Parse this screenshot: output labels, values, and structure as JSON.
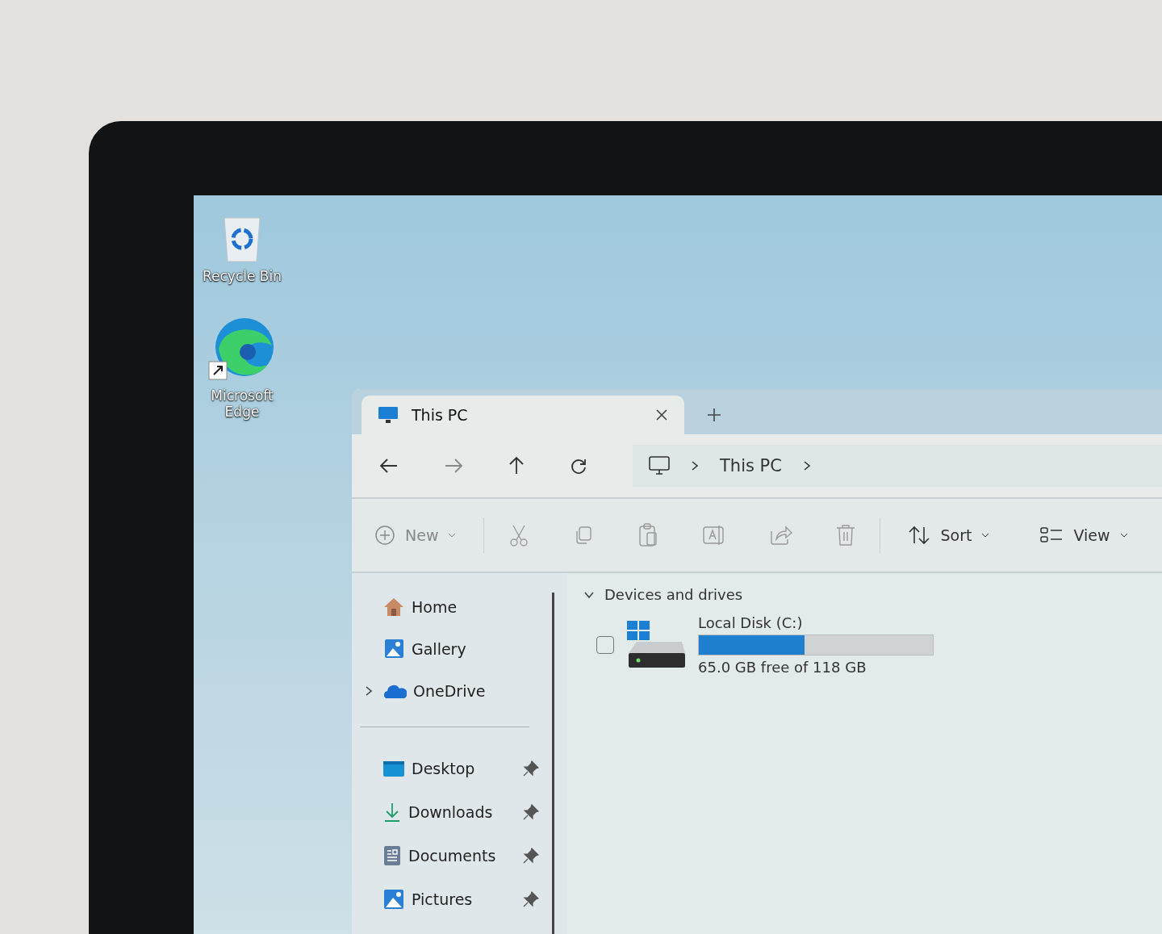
{
  "desktop_icons": [
    {
      "label": "Recycle Bin",
      "kind": "recycle"
    },
    {
      "label": "Microsoft Edge",
      "kind": "edge"
    }
  ],
  "window": {
    "tabs": [
      {
        "title": "This PC",
        "selected": true
      }
    ],
    "breadcrumb": [
      "This PC"
    ],
    "toolbar": {
      "new": "New",
      "sort": "Sort",
      "view": "View"
    },
    "sidebar": {
      "items": [
        {
          "label": "Home",
          "kind": "home",
          "expandable": false
        },
        {
          "label": "Gallery",
          "kind": "gallery",
          "expandable": false
        },
        {
          "label": "OneDrive",
          "kind": "cloud",
          "expandable": true
        }
      ],
      "quick_access": [
        {
          "label": "Desktop",
          "kind": "desktop",
          "pinned": true
        },
        {
          "label": "Downloads",
          "kind": "download",
          "pinned": true
        },
        {
          "label": "Documents",
          "kind": "document",
          "pinned": true
        },
        {
          "label": "Pictures",
          "kind": "picture",
          "pinned": true
        }
      ]
    },
    "content": {
      "group": {
        "title": "Devices and drives",
        "expanded": true
      },
      "drives": [
        {
          "name": "Local Disk (C:)",
          "free_text": "65.0 GB free of 118 GB",
          "level": 0.45,
          "checked": false
        }
      ]
    }
  }
}
